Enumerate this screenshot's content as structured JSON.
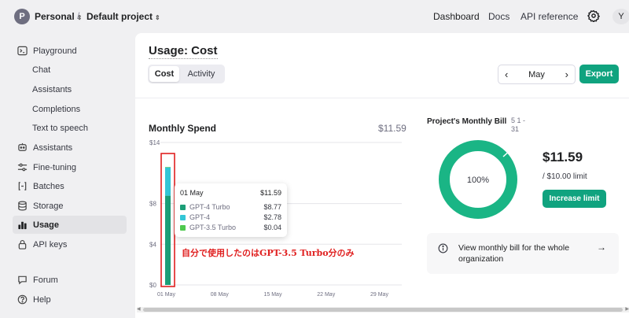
{
  "header": {
    "workspace_initial": "P",
    "workspace_name": "Personal",
    "separator": "/",
    "project_name": "Default project",
    "nav": [
      "Dashboard",
      "Docs",
      "API reference"
    ],
    "user_initial": "Y"
  },
  "sidebar": {
    "items": [
      {
        "label": "Playground",
        "icon": "terminal-icon"
      },
      {
        "label": "Chat",
        "icon": ""
      },
      {
        "label": "Assistants",
        "icon": ""
      },
      {
        "label": "Completions",
        "icon": ""
      },
      {
        "label": "Text to speech",
        "icon": ""
      },
      {
        "label": "Assistants",
        "icon": "robot-icon"
      },
      {
        "label": "Fine-tuning",
        "icon": "sliders-icon"
      },
      {
        "label": "Batches",
        "icon": "brackets-icon"
      },
      {
        "label": "Storage",
        "icon": "database-icon"
      },
      {
        "label": "Usage",
        "icon": "chart-bar-icon"
      },
      {
        "label": "API keys",
        "icon": "lock-icon"
      },
      {
        "label": "Forum",
        "icon": "chat-bubble-icon"
      },
      {
        "label": "Help",
        "icon": "help-circle-icon"
      }
    ],
    "active": "Usage"
  },
  "main": {
    "title": "Usage: Cost",
    "tabs": [
      "Cost",
      "Activity"
    ],
    "selected_tab": "Cost",
    "month": "May",
    "export_label": "Export",
    "spend_title": "Monthly Spend",
    "spend_total": "$11.59",
    "tooltip": {
      "date": "01 May",
      "total": "$11.59",
      "rows": [
        {
          "label": "GPT-4 Turbo",
          "value": "$8.77"
        },
        {
          "label": "GPT-4",
          "value": "$2.78"
        },
        {
          "label": "GPT-3.5 Turbo",
          "value": "$0.04"
        }
      ]
    },
    "annotation": "自分で使用したのはGPT-3.5 Turbo分のみ",
    "bill_title": "Project's Monthly Bill",
    "bill_range": "5 1 - 31",
    "bill_percent": "100%",
    "bill_amount": "$11.59",
    "bill_limit": "/ $10.00 limit",
    "increase_label": "Increase limit",
    "org_text": "View monthly bill for the whole organization"
  },
  "colors": {
    "accent": "#10a37f",
    "gpt4_turbo": "#1b9e77",
    "gpt4": "#33c6d6",
    "gpt35_turbo": "#4fc94f",
    "annotation": "#e02020",
    "donut": "#1ab585"
  },
  "chart_data": {
    "type": "bar",
    "stacked": true,
    "categories": [
      "01 May"
    ],
    "x_tick_labels": [
      "01 May",
      "08 May",
      "15 May",
      "22 May",
      "29 May"
    ],
    "y_tick_labels": [
      "$14",
      "$8",
      "$4",
      "$0"
    ],
    "ylim": [
      0,
      14
    ],
    "series": [
      {
        "name": "GPT-4 Turbo",
        "values": [
          8.77
        ]
      },
      {
        "name": "GPT-4",
        "values": [
          2.78
        ]
      },
      {
        "name": "GPT-3.5 Turbo",
        "values": [
          0.04
        ]
      }
    ],
    "grid": true
  }
}
